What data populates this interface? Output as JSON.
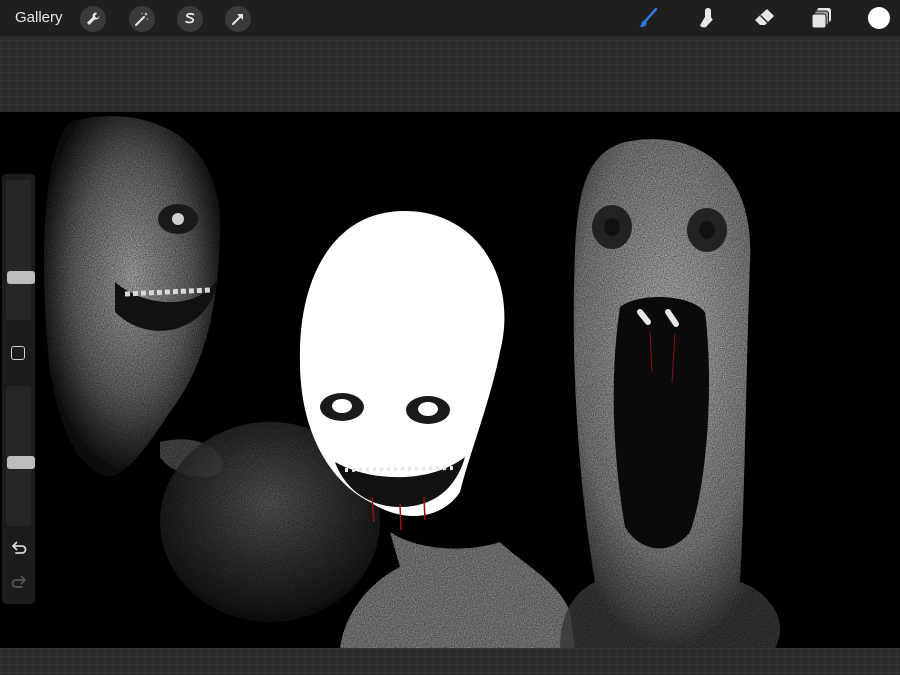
{
  "toolbar": {
    "gallery_label": "Gallery",
    "left_tools": [
      "wrench-icon",
      "magic-wand-icon",
      "selection-s-icon",
      "transform-arrow-icon"
    ],
    "right_tools": [
      "brush-icon",
      "smudge-icon",
      "eraser-icon",
      "layers-icon"
    ],
    "active_tool": "brush-icon",
    "active_color": "#ffffff",
    "accent_color": "#2f7df6"
  },
  "sidebar": {
    "brush_size_level": 0.72,
    "opacity_level": 0.55,
    "controls": [
      "modifier-square-icon",
      "undo-icon",
      "redo-icon"
    ]
  },
  "canvas": {
    "background_color": "#000000"
  }
}
